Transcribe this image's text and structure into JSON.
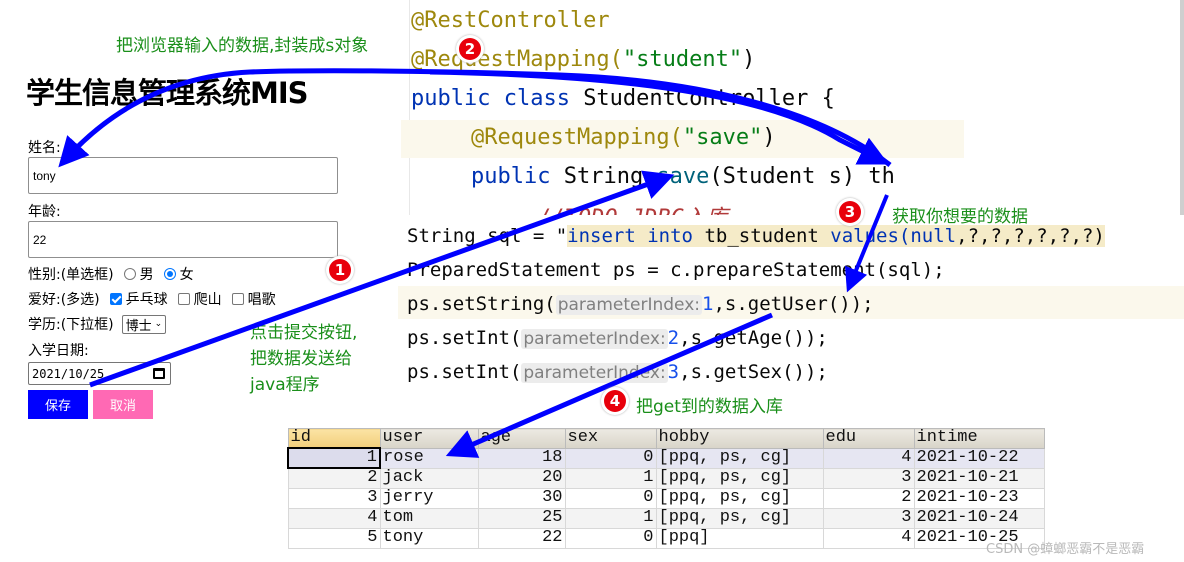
{
  "form": {
    "title": "学生信息管理系统MIS",
    "name_label": "姓名:",
    "name_value": "tony",
    "age_label": "年龄:",
    "age_value": "22",
    "gender_label": "性别:(单选框)",
    "gender_options": [
      {
        "label": "男",
        "checked": false
      },
      {
        "label": "女",
        "checked": true
      }
    ],
    "hobby_label": "爱好:(多选)",
    "hobby_options": [
      {
        "label": "乒乓球",
        "checked": true
      },
      {
        "label": "爬山",
        "checked": false
      },
      {
        "label": "唱歌",
        "checked": false
      }
    ],
    "edu_label": "学历:(下拉框)",
    "edu_selected": "博士",
    "date_label": "入学日期:",
    "date_value": "2021/10/25",
    "save_label": "保存",
    "cancel_label": "取消"
  },
  "code_top": {
    "line1": "@RestController",
    "line2_ann": "@RequestMapping(",
    "line2_str": "\"student\"",
    "line2_end": ")",
    "line3_kw": "public class ",
    "line3_rest": "StudentController {",
    "line4_ann": "@RequestMapping(",
    "line4_str": "\"save\"",
    "line4_end": ")",
    "line5_kw": "public ",
    "line5_type": "String ",
    "line5_fn": "save",
    "line5_rest": "(Student s) th",
    "line6_cmt": "//TODO JDBC入库"
  },
  "code_bottom": {
    "l1_a": "String sql = \"",
    "l1_str": "insert into ",
    "l1_tbl": "tb_student ",
    "l1_values": "values(",
    "l1_null": "null",
    "l1_rest": ",?,?,?,?,?,?)",
    "l2": "PreparedStatement ps = c.prepareStatement(sql);",
    "l3_a": "ps.setString(",
    "l3_hint": "parameterIndex:",
    "l3_num": "1",
    "l3_rest": ",s.getUser());",
    "l4_a": "ps.setInt(",
    "l4_hint": "parameterIndex:",
    "l4_num": "2",
    "l4_rest": ",s.getAge());",
    "l5_a": "ps.setInt(",
    "l5_hint": "parameterIndex:",
    "l5_num": "3",
    "l5_rest": ",s.getSex());"
  },
  "table": {
    "columns": [
      "id",
      "user",
      "age",
      "sex",
      "hobby",
      "edu",
      "intime"
    ],
    "rows": [
      [
        "1",
        "rose",
        "18",
        "0",
        "[ppq, ps, cg]",
        "4",
        "2021-10-22"
      ],
      [
        "2",
        "jack",
        "20",
        "1",
        "[ppq, ps, cg]",
        "3",
        "2021-10-21"
      ],
      [
        "3",
        "jerry",
        "30",
        "0",
        "[ppq, ps, cg]",
        "2",
        "2021-10-23"
      ],
      [
        "4",
        "tom",
        "25",
        "1",
        "[ppq, ps, cg]",
        "3",
        "2021-10-24"
      ],
      [
        "5",
        "tony",
        "22",
        "0",
        "[ppq]",
        "4",
        "2021-10-25"
      ]
    ]
  },
  "annotations": {
    "note_top": "把浏览器输入的数据,封装成s对象",
    "note_submit_1": "点击提交按钮,",
    "note_submit_2": "把数据发送给",
    "note_submit_3": "java程序",
    "note_get": "获取你想要的数据",
    "note_store": "把get到的数据入库",
    "badges": [
      "1",
      "2",
      "3",
      "4"
    ]
  },
  "colors": {
    "arrow": "#0000ff",
    "note": "#1a8f1a",
    "badge": "#e8000b",
    "save_button": "#0000ff",
    "cancel_button": "#ff69b4"
  },
  "watermark": "CSDN @蟑螂恶霸不是恶霸"
}
